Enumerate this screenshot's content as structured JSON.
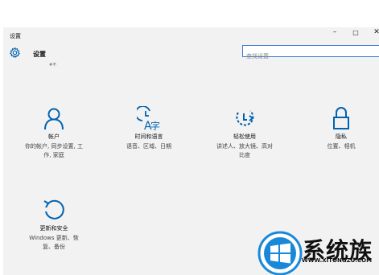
{
  "window": {
    "title": "设置",
    "minimize": "–",
    "maximize": "□",
    "close": "✕"
  },
  "header": {
    "app_title": "设置",
    "sub_text": "#不",
    "search_placeholder": "查找设置"
  },
  "tiles": [
    {
      "icon": "user-icon",
      "name": "帐户",
      "desc1": "你的帐户, 同步设置, 工",
      "desc2": "作, 家庭"
    },
    {
      "icon": "time-language-icon",
      "name": "时间和语言",
      "desc1": "语音、区域、日期",
      "desc2": ""
    },
    {
      "icon": "ease-of-access-icon",
      "name": "轻松使用",
      "desc1": "讲述人、放大镜、高对",
      "desc2": "比度"
    },
    {
      "icon": "lock-icon",
      "name": "隐私",
      "desc1": "位置、相机",
      "desc2": ""
    },
    {
      "icon": "update-security-icon",
      "name": "更新和安全",
      "desc1": "Windows 更新、恢",
      "desc2": "复、备份"
    }
  ],
  "watermark": {
    "text": "系统族",
    "url": "WWW.XITONGZU.COM"
  },
  "colors": {
    "accent": "#0063b1",
    "window_bg": "#f2f2f2",
    "search_border": "#3a7ad6"
  }
}
